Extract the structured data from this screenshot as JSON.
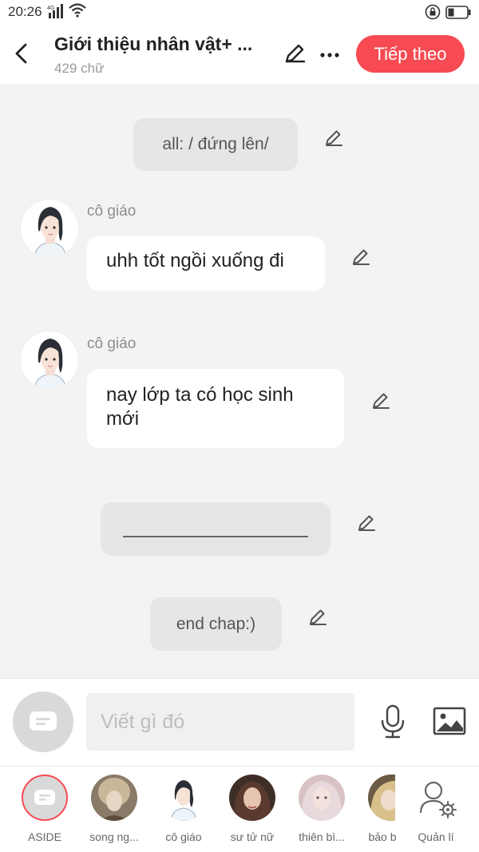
{
  "status_bar": {
    "time": "20:26",
    "network": "4G"
  },
  "header": {
    "title": "Giới thiệu nhân vật+ ...",
    "word_count": "429 chữ",
    "next_label": "Tiếp theo",
    "accent_color": "#f74a52"
  },
  "chat": {
    "narration_1": "all: / đứng lên/",
    "message_1": {
      "sender": "cô giáo",
      "text": "uhh tốt ngồi xuống đi"
    },
    "message_2": {
      "sender": "cô giáo",
      "text": "nay lớp ta có học sinh mới"
    },
    "narration_3": "end chap:)"
  },
  "composer": {
    "placeholder": "Viết gì đó"
  },
  "characters": [
    {
      "name": "ASIDE",
      "icon": "message-icon"
    },
    {
      "name": "song ng...",
      "icon": "avatar"
    },
    {
      "name": "cô giáo",
      "icon": "avatar"
    },
    {
      "name": "sư tử nữ",
      "icon": "avatar"
    },
    {
      "name": "thiên bì...",
      "icon": "avatar"
    },
    {
      "name": "bảo b",
      "icon": "avatar"
    },
    {
      "name": "Quản lí",
      "icon": "user-settings-icon"
    }
  ]
}
